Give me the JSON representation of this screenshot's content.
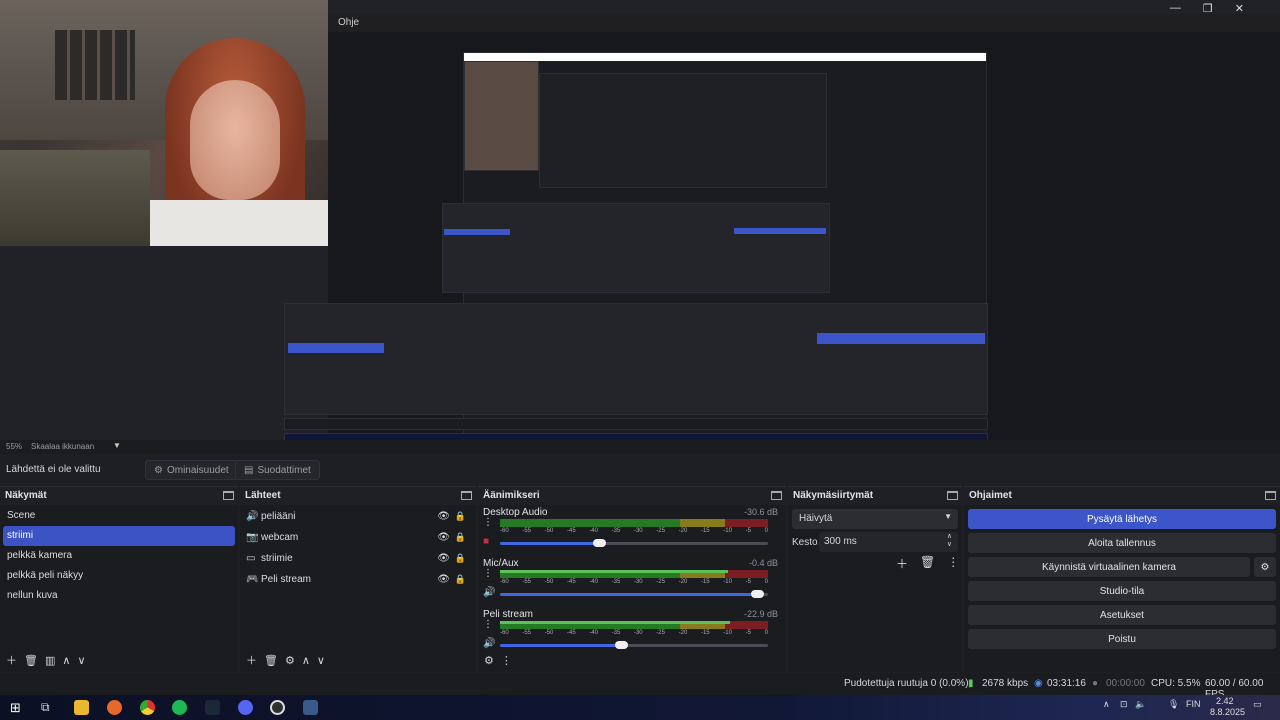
{
  "window": {
    "title": "Ohje"
  },
  "preview": {
    "zoom": "55%",
    "scale_label": "Skaalaa ikkunaan"
  },
  "source_bar": {
    "no_source": "Lähdettä ei ole valittu",
    "properties": "Ominaisuudet",
    "filters": "Suodattimet"
  },
  "scenes": {
    "title": "Näkymät",
    "items": [
      "Scene",
      "striimi",
      "pelkkä kamera",
      "pelkkä peli näkyy",
      "nellun kuva"
    ],
    "selected": "striimi"
  },
  "sources": {
    "title": "Lähteet",
    "items": [
      {
        "name": "peliääni",
        "icon": "speaker-icon"
      },
      {
        "name": "webcam",
        "icon": "camera-icon"
      },
      {
        "name": "striimie",
        "icon": "monitor-icon"
      },
      {
        "name": "Peli stream",
        "icon": "gamepad-icon"
      }
    ]
  },
  "mixer": {
    "title": "Äänimikseri",
    "ticks": [
      "-60",
      "-55",
      "-50",
      "-45",
      "-40",
      "-35",
      "-30",
      "-25",
      "-20",
      "-15",
      "-10",
      "-5",
      "0"
    ],
    "channels": [
      {
        "name": "Desktop Audio",
        "db": "-30.6 dB",
        "volume": 0.37,
        "muted": true
      },
      {
        "name": "Mic/Aux",
        "db": "-0.4 dB",
        "volume": 0.96,
        "muted": false
      },
      {
        "name": "Peli stream",
        "db": "-22.9 dB",
        "volume": 0.45,
        "muted": false
      }
    ]
  },
  "transitions": {
    "title": "Näkymäsiirtymät",
    "type": "Häivytä",
    "duration_label": "Kesto",
    "duration": "300 ms"
  },
  "controls": {
    "title": "Ohjaimet",
    "stop_stream": "Pysäytä lähetys",
    "start_recording": "Aloita tallennus",
    "virtual_cam": "Käynnistä virtuaalinen kamera",
    "studio": "Studio-tila",
    "settings": "Asetukset",
    "exit": "Poistu"
  },
  "status": {
    "dropped": "Pudotettuja ruutuja 0 (0.0%)",
    "bitrate": "2678 kbps",
    "stream_time": "03:31:16",
    "rec_time": "00:00:00",
    "cpu": "CPU: 5.5%",
    "fps": "60.00 / 60.00 FPS"
  },
  "taskbar": {
    "lang": "FIN",
    "time": "2.42",
    "date": "8.8.2025"
  },
  "colors": {
    "accent": "#3c55c9",
    "panel": "#1b1c20"
  }
}
